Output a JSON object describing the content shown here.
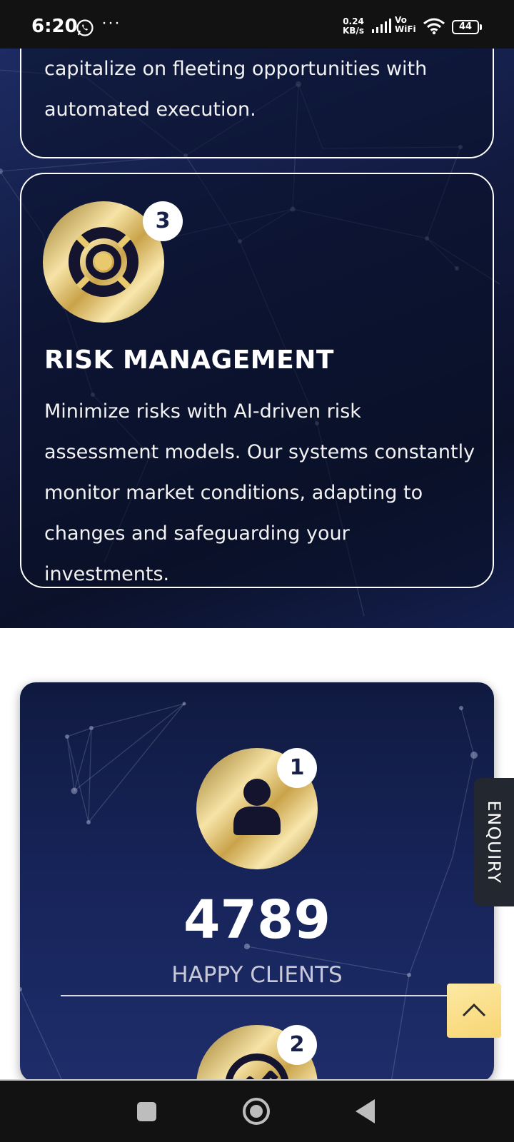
{
  "status_bar": {
    "time": "6:20",
    "more": "···",
    "net_speed_value": "0.24",
    "net_speed_unit": "KB/s",
    "vo": "Vo",
    "wifi_label": "WiFi",
    "battery": "44",
    "icons": [
      "whatsapp-icon",
      "signal-icon",
      "wifi-icon",
      "battery-icon"
    ]
  },
  "features": {
    "previous_card_text": "capitalize on fleeting opportunities with automated execution.",
    "risk_card": {
      "number": "3",
      "icon": "lifebuoy-icon",
      "title": "RISK MANAGEMENT",
      "description": "Minimize risks with AI-driven risk assessment models. Our systems constantly monitor market conditions, adapting to changes and safeguarding your investments."
    }
  },
  "stats": {
    "items": [
      {
        "number": "1",
        "icon": "user-icon",
        "value": "4789",
        "label": "HAPPY CLIENTS"
      },
      {
        "number": "2",
        "icon": "chart-icon"
      }
    ]
  },
  "enquiry_tab": {
    "label": "ENQUIRY"
  },
  "scroll_top": {
    "icon": "chevron-up-icon"
  },
  "nav_bar": {
    "icons": [
      "recents-icon",
      "home-icon",
      "back-icon"
    ]
  },
  "colors": {
    "dark_navy": "#121a40",
    "gold": "#e9c96e",
    "white": "#ffffff",
    "enquiry_bg": "#23272f"
  }
}
